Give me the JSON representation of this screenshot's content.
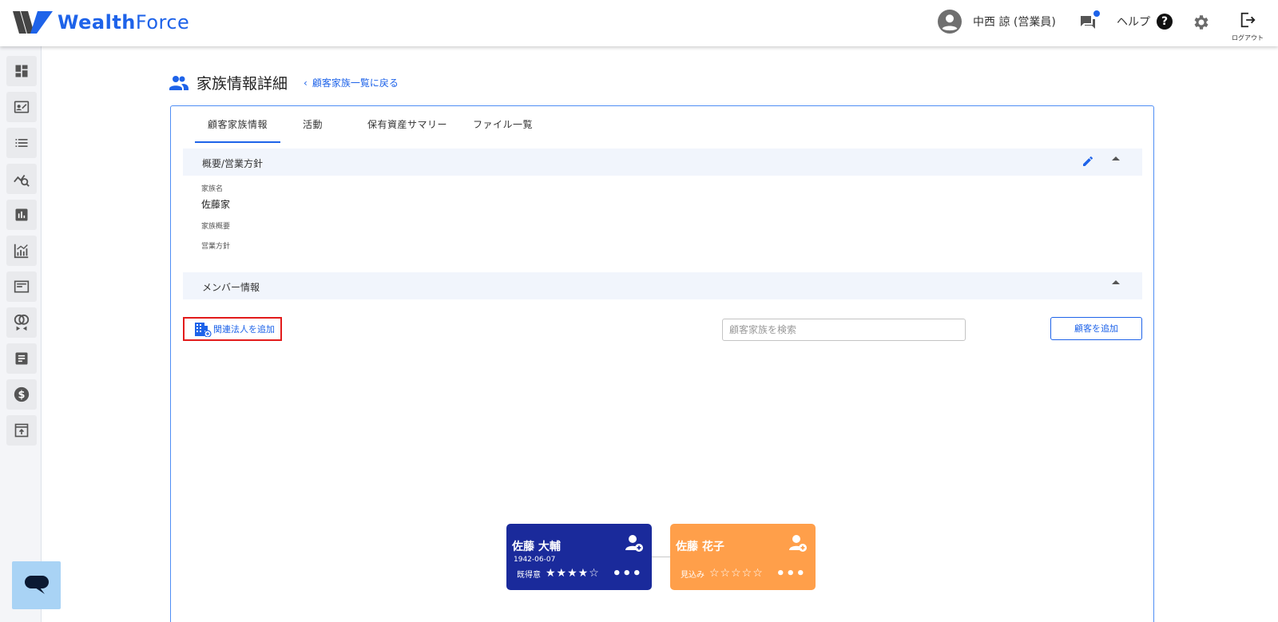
{
  "app": {
    "brand_w": "Wealth",
    "brand_f": "Force",
    "brand_color": "#1e63e9"
  },
  "header": {
    "user_name": "中西 諒 (営業員)",
    "help_label": "ヘルプ",
    "logout_label": "ログアウト"
  },
  "page": {
    "title": "家族情報詳細",
    "back_link": "顧客家族一覧に戻る"
  },
  "tabs": [
    {
      "label": "顧客家族情報",
      "active": true
    },
    {
      "label": "活動",
      "active": false
    },
    {
      "label": "保有資産サマリー",
      "active": false
    },
    {
      "label": "ファイル一覧",
      "active": false
    }
  ],
  "overview": {
    "section_title": "概要/営業方針",
    "family_name_label": "家族名",
    "family_name_value": "佐藤家",
    "family_summary_label": "家族概要",
    "sales_policy_label": "営業方針"
  },
  "members": {
    "section_title": "メンバー情報",
    "add_corp_label": "関連法人を追加",
    "search_placeholder": "顧客家族を検索",
    "add_customer_label": "顧客を追加",
    "nodes": [
      {
        "name": "佐藤 大輔",
        "dob": "1942-06-07",
        "status": "既得意",
        "stars": "★★★★☆",
        "rating": 4,
        "color": "#1a2a9b"
      },
      {
        "name": "佐藤 花子",
        "dob": "",
        "status": "見込み",
        "stars": "☆☆☆☆☆",
        "rating": 0,
        "color": "#ff9f4a"
      }
    ]
  }
}
